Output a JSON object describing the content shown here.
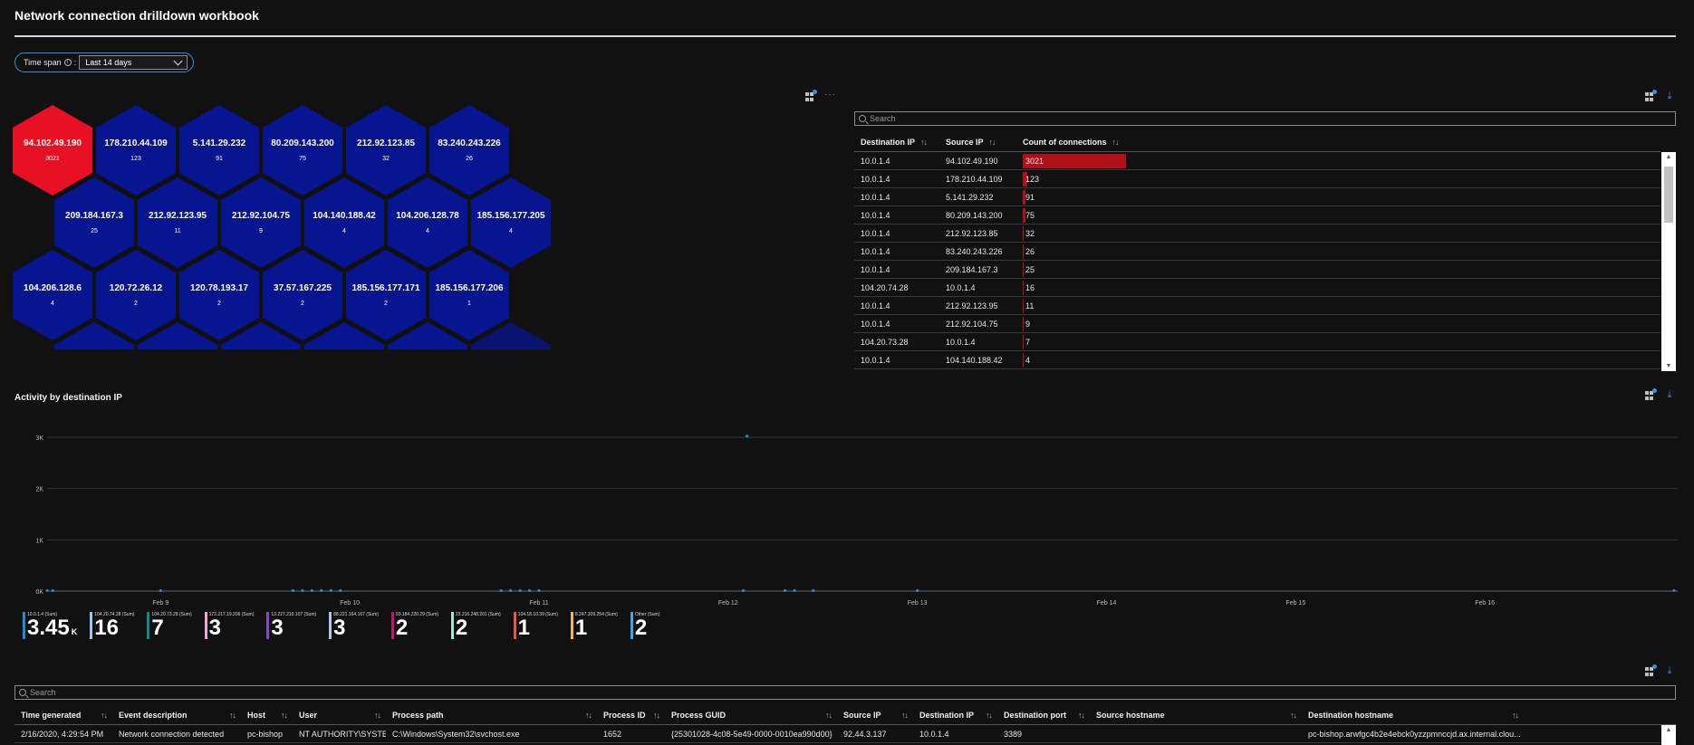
{
  "workbook": {
    "title": "Network connection drilldown workbook"
  },
  "params": {
    "time_span_label": "Time span",
    "info_icon": "info-icon",
    "colon": ":",
    "time_span_value": "Last 14 days"
  },
  "honeycomb": {
    "hot_color": "#e81123",
    "cold_color": "#071590",
    "rows": [
      [
        {
          "ip": "94.102.49.190",
          "count": "3021",
          "hot": true
        },
        {
          "ip": "178.210.44.109",
          "count": "123"
        },
        {
          "ip": "5.141.29.232",
          "count": "91"
        },
        {
          "ip": "80.209.143.200",
          "count": "75"
        },
        {
          "ip": "212.92.123.85",
          "count": "32"
        },
        {
          "ip": "83.240.243.226",
          "count": "26"
        }
      ],
      [
        {
          "ip": "209.184.167.3",
          "count": "25"
        },
        {
          "ip": "212.92.123.95",
          "count": "11"
        },
        {
          "ip": "212.92.104.75",
          "count": "9"
        },
        {
          "ip": "104.140.188.42",
          "count": "4"
        },
        {
          "ip": "104.206.128.78",
          "count": "4"
        },
        {
          "ip": "185.156.177.205",
          "count": "4"
        }
      ],
      [
        {
          "ip": "104.206.128.6",
          "count": "4"
        },
        {
          "ip": "120.72.26.12",
          "count": "2"
        },
        {
          "ip": "120.78.193.17",
          "count": "2"
        },
        {
          "ip": "37.57.167.225",
          "count": "2"
        },
        {
          "ip": "185.156.177.171",
          "count": "2"
        },
        {
          "ip": "185.156.177.206",
          "count": "1"
        }
      ]
    ]
  },
  "connections": {
    "search_placeholder": "Search",
    "headers": [
      "Destination IP",
      "Source IP",
      "Count of connections"
    ],
    "sort_icon": "↑↓",
    "bar_color": "#b0101a",
    "rows": [
      [
        "10.0.1.4",
        "94.102.49.190",
        "3021"
      ],
      [
        "10.0.1.4",
        "178.210.44.109",
        "123"
      ],
      [
        "10.0.1.4",
        "5.141.29.232",
        "91"
      ],
      [
        "10.0.1.4",
        "80.209.143.200",
        "75"
      ],
      [
        "10.0.1.4",
        "212.92.123.85",
        "32"
      ],
      [
        "10.0.1.4",
        "83.240.243.226",
        "26"
      ],
      [
        "10.0.1.4",
        "209.184.167.3",
        "25"
      ],
      [
        "104.20.74.28",
        "10.0.1.4",
        "16"
      ],
      [
        "10.0.1.4",
        "212.92.123.95",
        "11"
      ],
      [
        "10.0.1.4",
        "212.92.104.75",
        "9"
      ],
      [
        "104.20.73.28",
        "10.0.1.4",
        "7"
      ],
      [
        "10.0.1.4",
        "104.140.188.42",
        "4"
      ]
    ]
  },
  "activity": {
    "title": "Activity by destination IP",
    "chart_data": {
      "type": "scatter",
      "title": "Activity by destination IP",
      "xlabel": "",
      "ylabel": "",
      "x_ticks": [
        "Feb 9",
        "Feb 10",
        "Feb 11",
        "Feb 12",
        "Feb 13",
        "Feb 14",
        "Feb 15",
        "Feb 16"
      ],
      "y_ticks": [
        "0K",
        "1K",
        "2K",
        "3K"
      ],
      "ylim": [
        0,
        3000
      ],
      "xlim": [
        8.4,
        17.0
      ],
      "grid": true,
      "point_color": "#1f8ad8",
      "series": [
        {
          "x": [
            8.4,
            8.43,
            9.0,
            9.7,
            9.75,
            9.8,
            9.85,
            9.9,
            9.95,
            10.8,
            10.85,
            10.9,
            10.95,
            11.0,
            12.08,
            12.1,
            12.3,
            12.35,
            12.45,
            13.0,
            17.0
          ],
          "y": [
            10,
            10,
            10,
            10,
            10,
            10,
            10,
            10,
            10,
            10,
            10,
            10,
            10,
            10,
            10,
            3021,
            10,
            10,
            10,
            10,
            10
          ]
        }
      ]
    },
    "legend": [
      {
        "name": "10.0.1.4 (Sum)",
        "value": "3.45",
        "unit": "K",
        "color": "#1f8ad8"
      },
      {
        "name": "104.20.74.28 (Sum)",
        "value": "16",
        "color": "#9ec7ea"
      },
      {
        "name": "104.20.73.28 (Sum)",
        "value": "7",
        "color": "#0e8a8a"
      },
      {
        "name": "172.217.19.206 (Sum)",
        "value": "3",
        "color": "#f1a5d8"
      },
      {
        "name": "13.227.210.107 (Sum)",
        "value": "3",
        "color": "#8e44c8"
      },
      {
        "name": "88.221.164.167 (Sum)",
        "value": "3",
        "color": "#b4c4ec"
      },
      {
        "name": "93.184.220.29 (Sum)",
        "value": "2",
        "color": "#c21872"
      },
      {
        "name": "23.216.248.201 (Sum)",
        "value": "2",
        "color": "#a6e6d2"
      },
      {
        "name": "104.18.10.39 (Sum)",
        "value": "1",
        "color": "#e65a3c"
      },
      {
        "name": "8.247.209.254 (Sum)",
        "value": "1",
        "color": "#f2b36b"
      },
      {
        "name": "Other (Sum)",
        "value": "2",
        "color": "#4aa0e6"
      }
    ]
  },
  "events": {
    "search_placeholder": "Search",
    "sort_icon": "↑↓",
    "headers": [
      "Time generated",
      "Event description",
      "Host",
      "User",
      "Process path",
      "Process ID",
      "Process GUID",
      "Source IP",
      "Destination IP",
      "Destination port",
      "Source hostname",
      "Destination hostname"
    ],
    "rows": [
      [
        "2/16/2020, 4:29:54 PM",
        "Network connection detected",
        "pc-bishop",
        "NT AUTHORITY\\SYSTEM",
        "C:\\Windows\\System32\\svchost.exe",
        "1652",
        "{25301028-4c08-5e49-0000-0010ea990d00}",
        "92.44.3.137",
        "10.0.1.4",
        "3389",
        "",
        "pc-bishop.arwfgc4b2e4ebck0yzzpmnccjd.ax.internal.clou..."
      ]
    ]
  }
}
